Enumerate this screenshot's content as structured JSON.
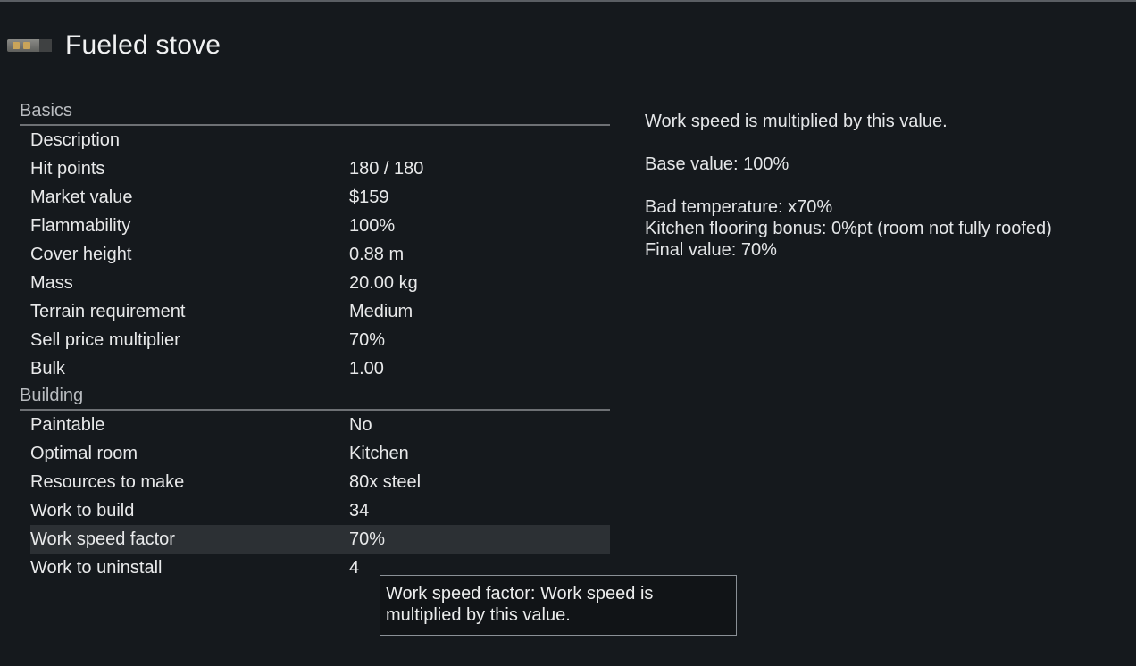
{
  "header": {
    "title": "Fueled stove",
    "icon": "fueled-stove-icon"
  },
  "basics": {
    "header": "Basics",
    "rows": [
      {
        "label": "Description",
        "value": ""
      },
      {
        "label": "Hit points",
        "value": "180 / 180"
      },
      {
        "label": "Market value",
        "value": "$159"
      },
      {
        "label": "Flammability",
        "value": "100%"
      },
      {
        "label": "Cover height",
        "value": "0.88 m"
      },
      {
        "label": "Mass",
        "value": "20.00 kg"
      },
      {
        "label": "Terrain requirement",
        "value": "Medium"
      },
      {
        "label": "Sell price multiplier",
        "value": "70%"
      },
      {
        "label": "Bulk",
        "value": "1.00"
      }
    ]
  },
  "building": {
    "header": "Building",
    "rows": [
      {
        "label": "Paintable",
        "value": "No"
      },
      {
        "label": "Optimal room",
        "value": "Kitchen"
      },
      {
        "label": "Resources to make",
        "value": "80x steel"
      },
      {
        "label": "Work to build",
        "value": "34"
      },
      {
        "label": "Work speed factor",
        "value": "70%"
      },
      {
        "label": "Work to uninstall",
        "value": "4"
      }
    ]
  },
  "detail": {
    "description": "Work speed is multiplied by this value.",
    "base_value": "Base value: 100%",
    "bad_temperature": "Bad temperature: x70%",
    "kitchen_flooring": "Kitchen flooring bonus: 0%pt (room not fully roofed)",
    "final_value": "Final value: 70%"
  },
  "tooltip": {
    "line1": "Work speed factor: Work speed is",
    "line2": "multiplied by this value."
  }
}
